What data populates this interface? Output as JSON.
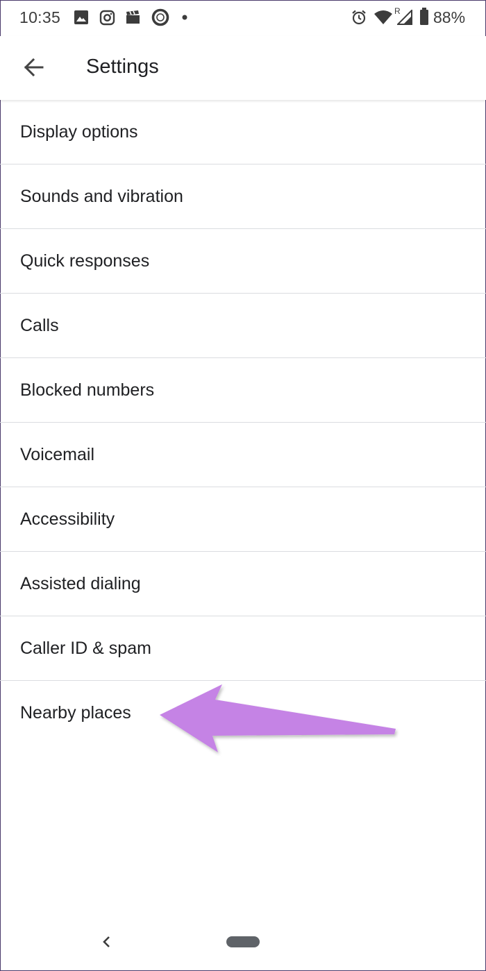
{
  "status_bar": {
    "time": "10:35",
    "battery_percent": "88%",
    "left_icons": [
      "image-icon",
      "instagram-icon",
      "clapperboard-icon",
      "circle-app-icon",
      "dot-icon"
    ],
    "right_icons": [
      "alarm-icon",
      "wifi-icon",
      "signal-icon",
      "battery-icon"
    ],
    "roaming_label": "R"
  },
  "app_bar": {
    "title": "Settings",
    "back_icon": "arrow-back-icon"
  },
  "settings": {
    "items": [
      {
        "label": "Display options"
      },
      {
        "label": "Sounds and vibration"
      },
      {
        "label": "Quick responses"
      },
      {
        "label": "Calls"
      },
      {
        "label": "Blocked numbers"
      },
      {
        "label": "Voicemail"
      },
      {
        "label": "Accessibility"
      },
      {
        "label": "Assisted dialing"
      },
      {
        "label": "Caller ID & spam"
      },
      {
        "label": "Nearby places"
      }
    ]
  },
  "annotation": {
    "icon": "pointer-arrow-icon",
    "color": "#c583e5"
  },
  "nav_bar": {
    "back_icon": "nav-back-icon",
    "home_icon": "home-pill-icon"
  }
}
